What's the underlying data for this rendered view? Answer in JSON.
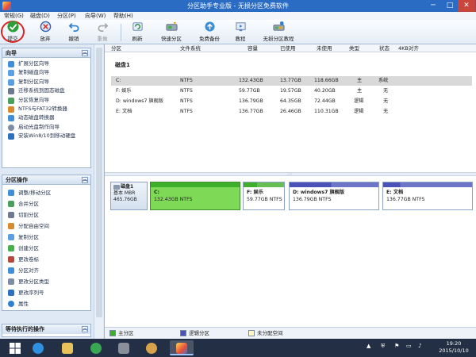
{
  "window": {
    "title": "分区助手专业版 - 无损分区免费软件",
    "min": "─",
    "max": "□",
    "close": "✕"
  },
  "menu": [
    "常规(G)",
    "磁盘(D)",
    "分区(P)",
    "向导(W)",
    "帮助(H)"
  ],
  "toolbar": {
    "commit": "提交",
    "discard": "放弃",
    "undo": "撤销",
    "redo": "重做",
    "refresh": "刷新",
    "quick_partition": "快速分区",
    "free_backup": "免费备份",
    "tutorial": "教程",
    "lossless_tutorial": "无损分区教程"
  },
  "wizard": {
    "title": "向导",
    "items": [
      "扩展分区向导",
      "复制磁盘向导",
      "复制分区向导",
      "迁移系统到固态磁盘",
      "分区恢复向导",
      "NTFS与FAT32转换器",
      "动态磁盘转换器",
      "启动光盘制作向导",
      "安装Win8/10到移动硬盘"
    ]
  },
  "ops": {
    "title": "分区操作",
    "items": [
      "调整/移动分区",
      "合并分区",
      "切割分区",
      "分配自由空间",
      "复制分区",
      "创建分区",
      "更改卷标",
      "分区对齐",
      "更改分区类型",
      "更改序列号",
      "属性"
    ]
  },
  "pending": {
    "title": "等待执行的操作"
  },
  "table": {
    "headers": [
      "分区",
      "文件系统",
      "容量",
      "已使用",
      "未使用",
      "类型",
      "状态",
      "4KB对齐"
    ],
    "disk_label": "磁盘1",
    "rows": [
      [
        "C:",
        "NTFS",
        "132.43GB",
        "13.77GB",
        "118.66GB",
        "主",
        "系统"
      ],
      [
        "F: 娱乐",
        "NTFS",
        "59.77GB",
        "19.57GB",
        "40.20GB",
        "主",
        "无"
      ],
      [
        "D: windows7 旗舰版",
        "NTFS",
        "136.79GB",
        "64.35GB",
        "72.44GB",
        "逻辑",
        "无"
      ],
      [
        "E: 文档",
        "NTFS",
        "136.77GB",
        "26.46GB",
        "110.31GB",
        "逻辑",
        "无"
      ]
    ]
  },
  "diskmap": {
    "disk_name": "磁盘1",
    "disk_type": "基本 MBR",
    "disk_size": "465.76GB",
    "partitions": [
      {
        "name": "C:",
        "size": "132.43GB NTFS",
        "used_fraction": 0.1,
        "color": "#3fae2a"
      },
      {
        "name": "F: 娱乐",
        "size": "59.77GB NTFS",
        "used_fraction": 0.33,
        "color": "#3fae2a"
      },
      {
        "name": "D: windows7 旗舰版",
        "size": "136.79GB NTFS",
        "used_fraction": 0.47,
        "color": "#4a52b8"
      },
      {
        "name": "E: 文档",
        "size": "136.77GB NTFS",
        "used_fraction": 0.19,
        "color": "#4a52b8"
      }
    ]
  },
  "legend": {
    "primary": "主分区",
    "logical": "逻辑分区",
    "unallocated": "未分配空间"
  },
  "colors": {
    "primary": "#3fae2a",
    "logical": "#4a52b8",
    "unallocated": "#fff7c4",
    "titlebar": "#2a6cc4",
    "selection": "#d9d9d9"
  },
  "tray": {
    "time": "19:20",
    "date": "2015/10/10"
  }
}
